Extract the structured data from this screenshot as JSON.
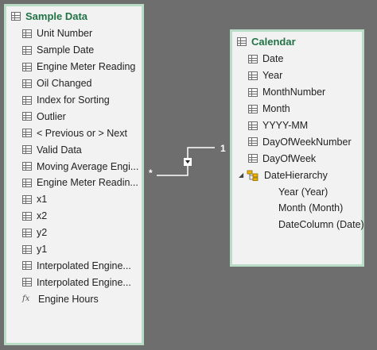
{
  "sample_data": {
    "title": "Sample Data",
    "fields": [
      {
        "label": "Unit Number",
        "icon": "table-column-icon"
      },
      {
        "label": "Sample Date",
        "icon": "table-column-icon"
      },
      {
        "label": "Engine Meter Reading",
        "icon": "table-column-icon"
      },
      {
        "label": "Oil Changed",
        "icon": "table-column-icon"
      },
      {
        "label": "Index for Sorting",
        "icon": "table-column-icon"
      },
      {
        "label": "Outlier",
        "icon": "table-column-icon"
      },
      {
        "label": "< Previous or > Next",
        "icon": "table-column-icon"
      },
      {
        "label": "Valid Data",
        "icon": "table-column-icon"
      },
      {
        "label": "Moving Average Engi...",
        "icon": "table-column-icon"
      },
      {
        "label": "Engine Meter Readin...",
        "icon": "table-column-icon"
      },
      {
        "label": "x1",
        "icon": "table-column-icon"
      },
      {
        "label": "x2",
        "icon": "table-column-icon"
      },
      {
        "label": "y2",
        "icon": "table-column-icon"
      },
      {
        "label": "y1",
        "icon": "table-column-icon"
      },
      {
        "label": "Interpolated Engine...",
        "icon": "table-column-icon"
      },
      {
        "label": "Interpolated Engine...",
        "icon": "table-column-icon"
      },
      {
        "label": "Engine Hours",
        "icon": "calculated-field-icon",
        "icon_glyph": "fx"
      }
    ]
  },
  "calendar": {
    "title": "Calendar",
    "fields": [
      {
        "label": "Date"
      },
      {
        "label": "Year"
      },
      {
        "label": "MonthNumber"
      },
      {
        "label": "Month"
      },
      {
        "label": "YYYY-MM"
      },
      {
        "label": "DayOfWeekNumber"
      },
      {
        "label": "DayOfWeek"
      }
    ],
    "hierarchy": {
      "label": "DateHierarchy",
      "levels": [
        {
          "label": "Year (Year)"
        },
        {
          "label": "Month (Month)"
        },
        {
          "label": "DateColumn (Date)"
        }
      ]
    }
  },
  "relationship": {
    "many_label": "*",
    "one_label": "1"
  },
  "colors": {
    "canvas": "#6e6e6e",
    "card_bg": "#f2f2f2",
    "card_border": "#b9dcc6",
    "title_text": "#217346",
    "relationship_line": "#ffffff"
  }
}
